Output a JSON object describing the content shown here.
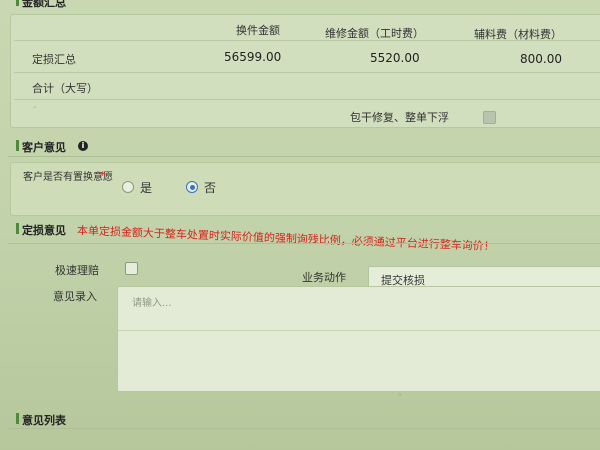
{
  "amount_summary": {
    "section_title": "金额汇总",
    "col_replace": "换件金额",
    "col_repair": "维修金额（工时费）",
    "col_material": "辅料费（材料费）",
    "row_label": "定损汇总",
    "replace_value": "56599.00",
    "repair_value": "5520.00",
    "material_value": "800.00",
    "total_label": "合计（大写）",
    "package_label": "包干修复、整单下浮"
  },
  "customer_opinion": {
    "section_title": "客户意见",
    "question": "客户是否有置换意愿",
    "required_mark": "*",
    "option_yes": "是",
    "option_no": "否",
    "selected": "否"
  },
  "loss_opinion": {
    "section_title": "定损意见",
    "warning": "本单定损金额大于整车处置时实际价值的强制询残比例，必须通过平台进行整车询价！",
    "fast_claim_label": "极速理赔",
    "action_label": "业务动作",
    "action_value": "提交核损",
    "opinion_label": "意见录入",
    "opinion_placeholder": "请输入..."
  },
  "opinion_list": {
    "section_title": "意见列表"
  },
  "colors": {
    "accent": "#4f8a3c",
    "warning": "#d6231c",
    "radio_selected": "#3a6fc4"
  }
}
